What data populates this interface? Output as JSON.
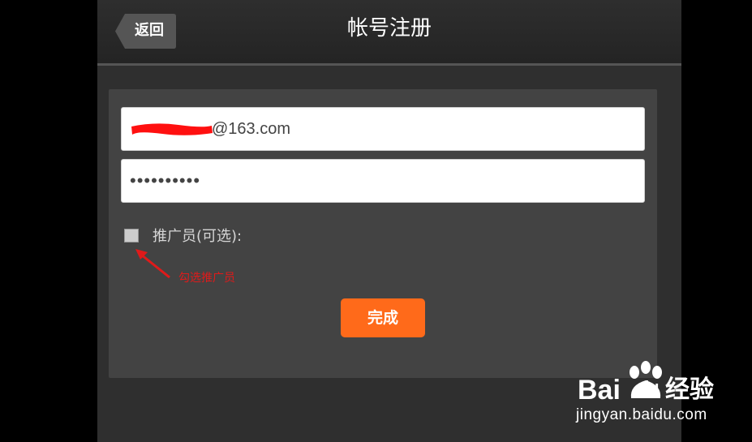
{
  "header": {
    "back_label": "返回",
    "title": "帐号注册"
  },
  "form": {
    "email_value": "@163.com",
    "password_value": "••••••••••",
    "promoter_label": "推广员(可选):",
    "promoter_checked": false,
    "submit_label": "完成"
  },
  "annotation": {
    "text": "勾选推广员",
    "color": "#e01a1a"
  },
  "watermark": {
    "brand_left": "Bai",
    "brand_mid": "du",
    "brand_right": "经验",
    "url": "jingyan.baidu.com"
  },
  "colors": {
    "accent": "#ff6a1a",
    "background": "#2f2f2f",
    "panel": "#434343"
  }
}
